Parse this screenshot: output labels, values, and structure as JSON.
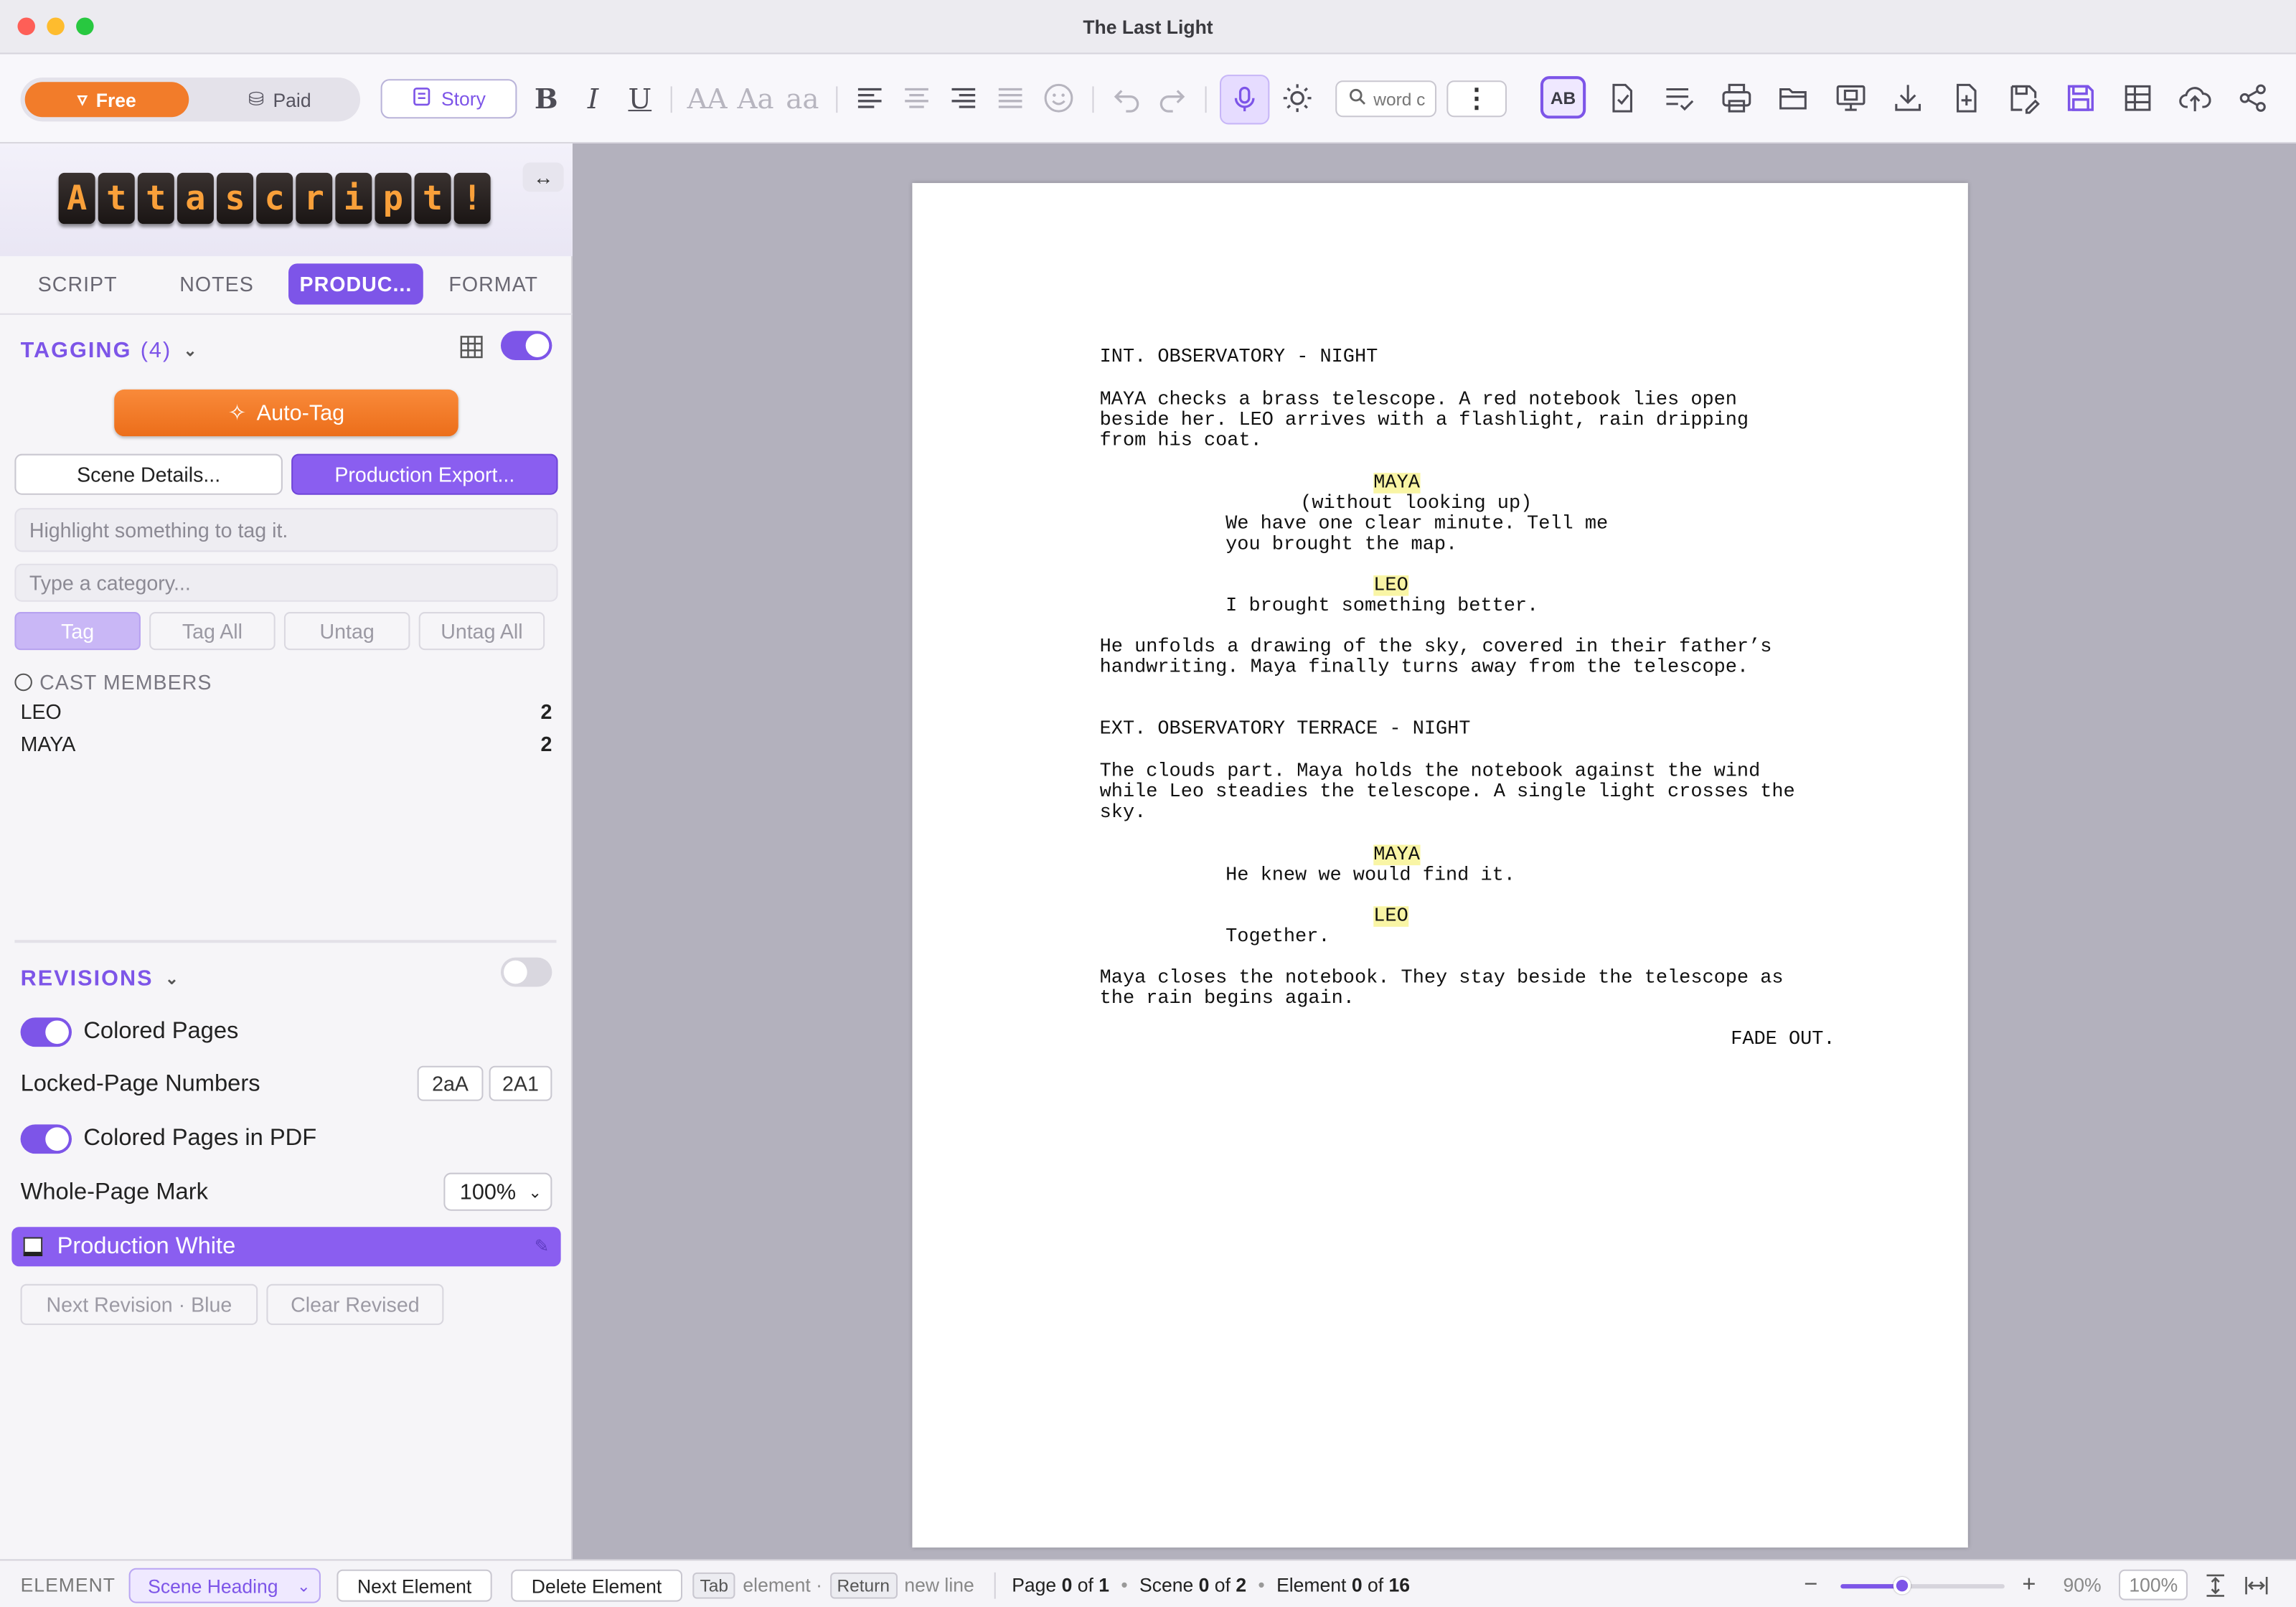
{
  "window": {
    "title": "The Last Light"
  },
  "toolbar": {
    "free_label": "Free",
    "paid_label": "Paid",
    "story_label": "Story",
    "format_sizes": [
      "AA",
      "Aa",
      "aa"
    ],
    "search_placeholder": "word c",
    "more_label": "⋮",
    "spellcheck_label": "AB"
  },
  "sidebar": {
    "logo_letters": [
      "A",
      "t",
      "t",
      "a",
      "s",
      "c",
      "r",
      "i",
      "p",
      "t",
      "!"
    ],
    "expand_label": "↔",
    "tabs": [
      "SCRIPT",
      "NOTES",
      "PRODUC...",
      "FORMAT"
    ],
    "tagging": {
      "title": "TAGGING",
      "count": "(4)",
      "enabled": true,
      "autotag_label": "Auto-Tag",
      "scene_details_label": "Scene Details...",
      "production_export_label": "Production Export...",
      "highlight_hint": "Highlight something to tag it.",
      "category_placeholder": "Type a category...",
      "buttons": [
        "Tag",
        "Tag All",
        "Untag",
        "Untag All"
      ],
      "cast_header": "CAST MEMBERS",
      "cast": [
        {
          "name": "LEO",
          "count": "2"
        },
        {
          "name": "MAYA",
          "count": "2"
        }
      ]
    },
    "revisions": {
      "title": "REVISIONS",
      "enabled": false,
      "colored_pages": "Colored Pages",
      "locked_page_numbers": "Locked-Page Numbers",
      "lock_opt_1": "2aA",
      "lock_opt_2": "2A1",
      "colored_pages_pdf": "Colored Pages in PDF",
      "whole_page_mark": "Whole-Page Mark",
      "whole_page_value": "100%",
      "current_revision": "Production White",
      "next_revision": "Next Revision · Blue",
      "clear_revised": "Clear Revised"
    }
  },
  "script": {
    "lines": [
      "INT. OBSERVATORY - NIGHT",
      "MAYA checks a brass telescope. A red notebook lies open",
      "beside her. LEO arrives with a flashlight, rain dripping",
      "from his coat.",
      "MAYA",
      "(without looking up)",
      "We have one clear minute. Tell me",
      "you brought the map.",
      "LEO",
      "I brought something better.",
      "He unfolds a drawing of the sky, covered in their father’s",
      "handwriting. Maya finally turns away from the telescope.",
      "EXT. OBSERVATORY TERRACE - NIGHT",
      "The clouds part. Maya holds the notebook against the wind",
      "while Leo steadies the telescope. A single light crosses the",
      "sky.",
      "MAYA",
      "He knew we would find it.",
      "LEO",
      "Together.",
      "Maya closes the notebook. They stay beside the telescope as",
      "the rain begins again.",
      "FADE OUT."
    ]
  },
  "statusbar": {
    "element_label": "ELEMENT",
    "element_value": "Scene Heading",
    "next_element": "Next Element",
    "delete_element": "Delete Element",
    "tab_key": "Tab",
    "tab_hint": "element ·",
    "return_key": "Return",
    "return_hint": "new line",
    "page_word": "Page",
    "page_cur": "0",
    "page_of": "of",
    "page_total": "1",
    "scene_word": "Scene",
    "scene_cur": "0",
    "scene_of": "of",
    "scene_total": "2",
    "element_word": "Element",
    "element_cur": "0",
    "element_of": "of",
    "element_total": "16",
    "zoom_minus": "−",
    "zoom_plus": "+",
    "zoom_level": 90,
    "zoom_text": "90%",
    "zoom_reset": "100%"
  },
  "colors": {
    "accent": "#7d55e8",
    "orange": "#f27c2a",
    "highlight": "#f9f5a5"
  }
}
